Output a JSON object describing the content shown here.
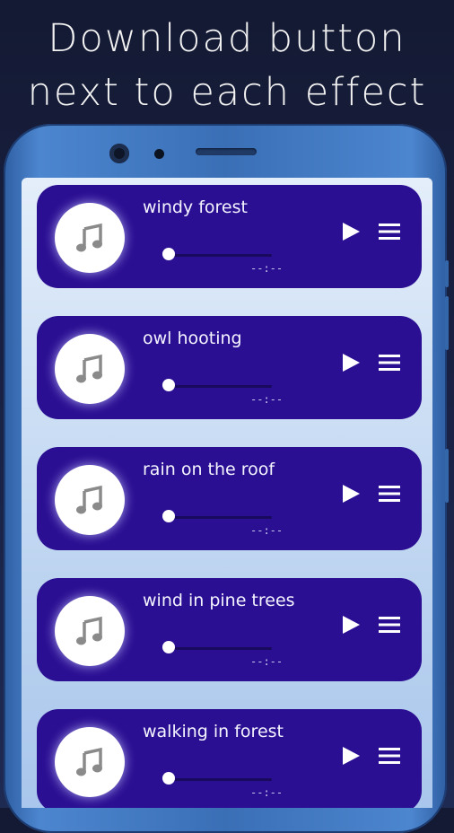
{
  "headline": {
    "line1": "Download button",
    "line2": "next to each effect"
  },
  "sounds": [
    {
      "title": "windy forest",
      "time": "--:--",
      "progress": 0
    },
    {
      "title": "owl hooting",
      "time": "--:--",
      "progress": 0
    },
    {
      "title": "rain on the roof",
      "time": "--:--",
      "progress": 0
    },
    {
      "title": "wind in pine trees",
      "time": "--:--",
      "progress": 0
    },
    {
      "title": "walking in forest",
      "time": "--:--",
      "progress": 0
    }
  ],
  "icons": {
    "album": "music-note-icon",
    "play": "play-icon",
    "menu": "menu-icon"
  },
  "colors": {
    "card": "#2b0f93",
    "headline": "#f2f2f2",
    "phone_frame": "#3a6fb6"
  }
}
